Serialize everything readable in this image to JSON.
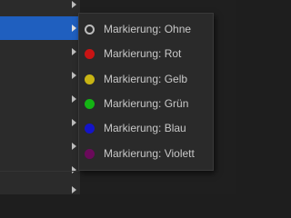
{
  "parent_menu": {
    "rows": [
      {
        "has_submenu": true,
        "active": false
      },
      {
        "has_submenu": true,
        "active": true
      },
      {
        "has_submenu": true,
        "active": false
      },
      {
        "has_submenu": true,
        "active": false
      },
      {
        "has_submenu": true,
        "active": false
      },
      {
        "has_submenu": true,
        "active": false
      },
      {
        "has_submenu": true,
        "active": false
      },
      {
        "has_submenu": true,
        "active": false
      },
      {
        "has_submenu": true,
        "active": false
      }
    ]
  },
  "submenu": {
    "items": [
      {
        "label": "Markierung: Ohne",
        "color": "none",
        "icon": "empty-circle-icon"
      },
      {
        "label": "Markierung: Rot",
        "color": "#c81414",
        "icon": "red-dot-icon"
      },
      {
        "label": "Markierung: Gelb",
        "color": "#c8b414",
        "icon": "yellow-dot-icon"
      },
      {
        "label": "Markierung: Grün",
        "color": "#14b414",
        "icon": "green-dot-icon"
      },
      {
        "label": "Markierung: Blau",
        "color": "#1414c8",
        "icon": "blue-dot-icon"
      },
      {
        "label": "Markierung: Violett",
        "color": "#6a0a5a",
        "icon": "violet-dot-icon"
      }
    ]
  }
}
